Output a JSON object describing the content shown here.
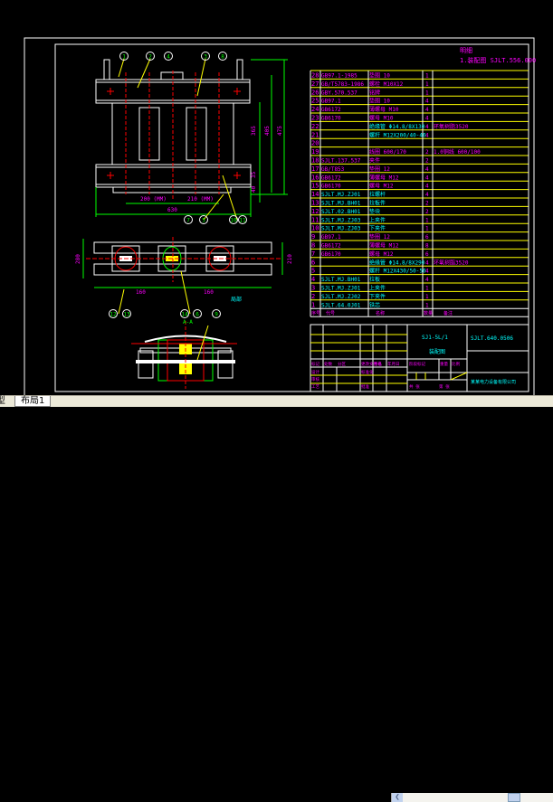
{
  "colors": {
    "background": "#000000",
    "frame": "#ffffff",
    "table_lines": "#ffff00",
    "text_primary": "#ff00ff",
    "text_secondary": "#00ffff",
    "dimension": "#00ff00",
    "centerline": "#ff0000",
    "leader": "#ffff00"
  },
  "drawing": {
    "title_top": "明细",
    "title_top_code": "1.装配图 SJLT.556.000",
    "dims": {
      "top_h1": "365",
      "top_h2": "405",
      "top_h3": "475",
      "top_b1": "35",
      "top_b2": "40",
      "top_b3": "25",
      "top_w1": "200 (MM)",
      "top_w2": "210 (MM)",
      "top_total": "630",
      "mid_h1": "280",
      "mid_h2": "210",
      "mid_w1": "160",
      "mid_w2": "160",
      "mid_label": "局部",
      "sec_label": "A-A"
    },
    "balloons": [
      "1",
      "2",
      "4",
      "3",
      "8",
      "7",
      "5",
      "10",
      "11",
      "12",
      "13",
      "14",
      "6",
      "9"
    ]
  },
  "parts_list": {
    "rows": [
      {
        "no": "28",
        "code": "GB97.1-1985",
        "name": "垫圈 10",
        "qty": "1",
        "note": ""
      },
      {
        "no": "27",
        "code": "GB/T5783-1986",
        "name": "螺栓 M10X12",
        "qty": "1",
        "note": ""
      },
      {
        "no": "26",
        "code": "GBY.570.537",
        "name": "铭牌",
        "qty": "1",
        "note": ""
      },
      {
        "no": "25",
        "code": "GB97.1",
        "name": "垫圈 10",
        "qty": "4",
        "note": ""
      },
      {
        "no": "24",
        "code": "GB6172",
        "name": "薄螺母 M10",
        "qty": "4",
        "note": ""
      },
      {
        "no": "23",
        "code": "GB6170",
        "name": "螺母 M10",
        "qty": "4",
        "note": ""
      },
      {
        "no": "22",
        "code": "",
        "name": "绝缘管 Φ14.8/8X130",
        "qty": "4",
        "note": "环氧树脂3520",
        "cyan": true
      },
      {
        "no": "21",
        "code": "",
        "name": "螺杆 M12X200/40-40",
        "qty": "4",
        "note": "",
        "cyan": true
      },
      {
        "no": "20",
        "code": "",
        "name": "",
        "qty": "",
        "note": ""
      },
      {
        "no": "19",
        "code": "",
        "name": "线圈 600/170",
        "qty": "2",
        "note": "1.0铜线 600/100"
      },
      {
        "no": "18",
        "code": "SJLT.137.537",
        "name": "夹件",
        "qty": "2",
        "note": ""
      },
      {
        "no": "17",
        "code": "GB/T853",
        "name": "垫圈 12",
        "qty": "4",
        "note": ""
      },
      {
        "no": "16",
        "code": "GB6172",
        "name": "薄螺母 M12",
        "qty": "4",
        "note": ""
      },
      {
        "no": "15",
        "code": "GB6170",
        "name": "螺母 M12",
        "qty": "4",
        "note": ""
      },
      {
        "no": "14",
        "code": "SJLT.MJ.ZJ01",
        "name": "拉螺杆",
        "qty": "4",
        "note": "",
        "cyan": true
      },
      {
        "no": "13",
        "code": "SJLT.MJ.BH01",
        "name": "拉板件",
        "qty": "2",
        "note": "",
        "cyan": true
      },
      {
        "no": "12",
        "code": "SJLT.02.BH01",
        "name": "垫块",
        "qty": "2",
        "note": "",
        "cyan": true
      },
      {
        "no": "11",
        "code": "SJLT.MJ.ZJ03",
        "name": "上夹件",
        "qty": "1",
        "note": "",
        "cyan": true
      },
      {
        "no": "10",
        "code": "SJLT.MJ.ZJ03",
        "name": "下夹件",
        "qty": "1",
        "note": "",
        "cyan": true
      },
      {
        "no": "9",
        "code": "GB97.1",
        "name": "垫圈 12",
        "qty": "6",
        "note": ""
      },
      {
        "no": "8",
        "code": "GB6172",
        "name": "薄螺母 M12",
        "qty": "8",
        "note": ""
      },
      {
        "no": "7",
        "code": "GB6170",
        "name": "螺母 M12",
        "qty": "6",
        "note": ""
      },
      {
        "no": "6",
        "code": "",
        "name": "绝缘管 Φ14.8/8X290",
        "qty": "4",
        "note": "环氧树脂3520",
        "cyan": true
      },
      {
        "no": "5",
        "code": "",
        "name": "螺杆 M12X430/50-50",
        "qty": "4",
        "note": "",
        "cyan": true
      },
      {
        "no": "4",
        "code": "SJLT.MJ.BH01",
        "name": "拉板",
        "qty": "4",
        "note": "",
        "cyan": true
      },
      {
        "no": "3",
        "code": "SJLT.MJ.ZJ01",
        "name": "上夹件",
        "qty": "1",
        "note": "",
        "cyan": true
      },
      {
        "no": "2",
        "code": "SJLT.MJ.ZJ02",
        "name": "下夹件",
        "qty": "1",
        "note": "",
        "cyan": true
      },
      {
        "no": "1",
        "code": "SJLT.64.0J01",
        "name": "铁芯",
        "qty": "1",
        "note": "",
        "cyan": true
      }
    ],
    "header": {
      "no": "序号",
      "code": "代号",
      "name": "名称",
      "qty": "数量",
      "note": "备注"
    }
  },
  "title_block": {
    "product": "SJ1-5L/1",
    "drawing_name": "装配图",
    "drawing_code": "SJLT.640.0506",
    "company": "某某电力设备有限公司",
    "labels": {
      "mark": "标记",
      "count": "处数",
      "zone": "分区",
      "change_doc": "更改文件号",
      "signature": "签名",
      "date": "年月日",
      "design": "设计",
      "check": "审核",
      "process": "工艺",
      "approve": "批准",
      "standardize": "标准化",
      "stage_mark": "阶段标记",
      "weight": "重量",
      "scale": "比例",
      "sheet_total": "共 张",
      "sheet_no": "第 张"
    }
  },
  "tabs": {
    "model": "型",
    "layout1": "布局1"
  }
}
